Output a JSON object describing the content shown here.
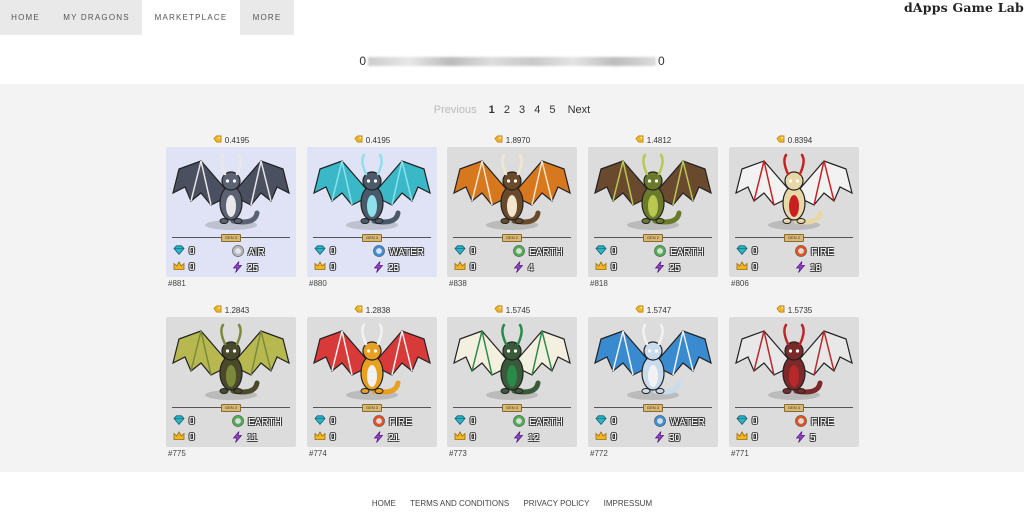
{
  "nav": {
    "items": [
      {
        "label": "HOME"
      },
      {
        "label": "MY DRAGONS"
      },
      {
        "label": "MARKETPLACE"
      },
      {
        "label": "MORE"
      }
    ]
  },
  "brand": "dApps Game Lab",
  "address": {
    "prefix": "0",
    "suffix": "0"
  },
  "pagination": {
    "previous": "Previous",
    "pages": [
      "1",
      "2",
      "3",
      "4",
      "5"
    ],
    "current": "1",
    "next": "Next"
  },
  "dragons": [
    {
      "price": "0.4195",
      "gen": "GEN 3",
      "gems": "0",
      "crowns": "0",
      "element": "AIR",
      "element_color": "#b8b8b8",
      "power": "25",
      "id": "#881",
      "bg": "blue",
      "body": "#5a6274",
      "wing": "#4a5060",
      "accent": "#e8e8e8"
    },
    {
      "price": "0.4195",
      "gen": "GEN 3",
      "gems": "0",
      "crowns": "0",
      "element": "WATER",
      "element_color": "#3a8fd6",
      "power": "23",
      "id": "#880",
      "bg": "blue",
      "body": "#4a5a6a",
      "wing": "#3ab8c8",
      "accent": "#8ee0ea"
    },
    {
      "price": "1.8970",
      "gen": "GEN 2",
      "gems": "0",
      "crowns": "0",
      "element": "EARTH",
      "element_color": "#4caf50",
      "power": "4",
      "id": "#838",
      "bg": "gray",
      "body": "#6a4a2a",
      "wing": "#d8781e",
      "accent": "#f2e6cf"
    },
    {
      "price": "1.4812",
      "gen": "GEN 2",
      "gems": "0",
      "crowns": "0",
      "element": "EARTH",
      "element_color": "#4caf50",
      "power": "25",
      "id": "#818",
      "bg": "gray",
      "body": "#6a7a2a",
      "wing": "#6a4a2e",
      "accent": "#b8c850"
    },
    {
      "price": "0.8394",
      "gen": "GEN 2",
      "gems": "0",
      "crowns": "0",
      "element": "FIRE",
      "element_color": "#e8501e",
      "power": "18",
      "id": "#806",
      "bg": "gray",
      "body": "#e8d8a8",
      "wing": "#f2f2f2",
      "accent": "#c82020"
    },
    {
      "price": "1.2843",
      "gen": "GEN 3",
      "gems": "0",
      "crowns": "0",
      "element": "EARTH",
      "element_color": "#4caf50",
      "power": "11",
      "id": "#775",
      "bg": "gray",
      "body": "#4a4a2a",
      "wing": "#b8b850",
      "accent": "#7a8a3a"
    },
    {
      "price": "1.2838",
      "gen": "GEN 3",
      "gems": "0",
      "crowns": "0",
      "element": "FIRE",
      "element_color": "#e8501e",
      "power": "21",
      "id": "#774",
      "bg": "gray",
      "body": "#e8a020",
      "wing": "#d83a3a",
      "accent": "#f2f2f2"
    },
    {
      "price": "1.5745",
      "gen": "GEN 3",
      "gems": "0",
      "crowns": "0",
      "element": "EARTH",
      "element_color": "#4caf50",
      "power": "12",
      "id": "#773",
      "bg": "gray",
      "body": "#3a5a3a",
      "wing": "#f4f0e0",
      "accent": "#2a8a4a"
    },
    {
      "price": "1.5747",
      "gen": "GEN 3",
      "gems": "0",
      "crowns": "0",
      "element": "WATER",
      "element_color": "#3a8fd6",
      "power": "30",
      "id": "#772",
      "bg": "gray",
      "body": "#c8dcee",
      "wing": "#3a8ad0",
      "accent": "#f2f2f2"
    },
    {
      "price": "1.5735",
      "gen": "GEN 3",
      "gems": "0",
      "crowns": "0",
      "element": "FIRE",
      "element_color": "#e8501e",
      "power": "5",
      "id": "#771",
      "bg": "gray",
      "body": "#7a2a2a",
      "wing": "#e8e8e8",
      "accent": "#b82828"
    }
  ],
  "footer": {
    "links": [
      {
        "label": "HOME"
      },
      {
        "label": "TERMS AND CONDITIONS"
      },
      {
        "label": "PRIVACY POLICY"
      },
      {
        "label": "IMPRESSUM"
      }
    ]
  },
  "icons": {
    "price": "price-tag-icon",
    "gems": "diamond-icon",
    "crowns": "crown-icon",
    "element": "element-ring-icon",
    "power": "lightning-bolt-icon"
  }
}
